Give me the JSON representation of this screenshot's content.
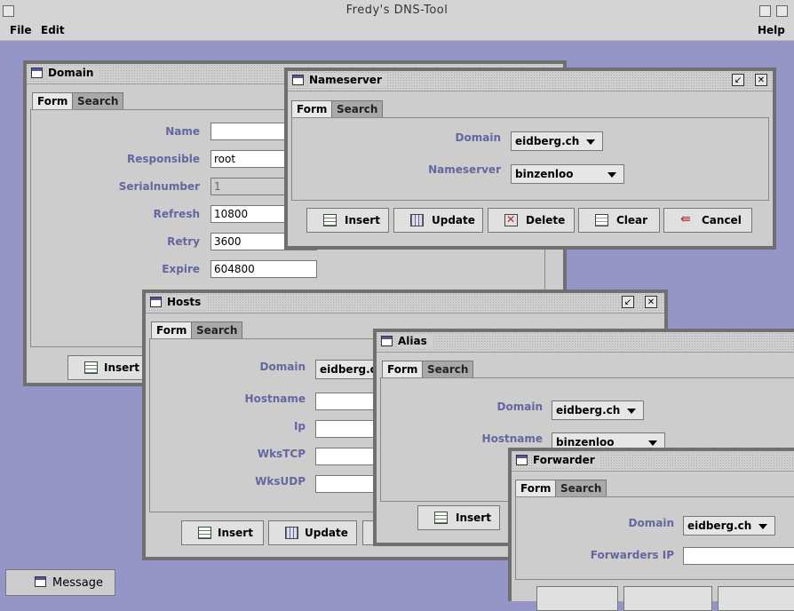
{
  "app": {
    "title": "Fredy's DNS-Tool"
  },
  "menu": {
    "file": "File",
    "edit": "Edit",
    "help": "Help"
  },
  "tabs": {
    "form": "Form",
    "search": "Search"
  },
  "buttons": {
    "insert": "Insert",
    "update": "Update",
    "delete": "Delete",
    "clear": "Clear",
    "cancel": "Cancel"
  },
  "domain_window": {
    "title": "Domain",
    "fields": [
      {
        "label": "Name",
        "value": ""
      },
      {
        "label": "Responsible",
        "value": "root"
      },
      {
        "label": "Serialnumber",
        "value": "1"
      },
      {
        "label": "Refresh",
        "value": "10800"
      },
      {
        "label": "Retry",
        "value": "3600"
      },
      {
        "label": "Expire",
        "value": "604800"
      }
    ]
  },
  "nameserver_window": {
    "title": "Nameserver",
    "domain_label": "Domain",
    "domain_value": "eidberg.ch",
    "nameserver_label": "Nameserver",
    "nameserver_value": "binzenloo"
  },
  "hosts_window": {
    "title": "Hosts",
    "domain_label": "Domain",
    "domain_value": "eidberg.ch",
    "fields": [
      {
        "label": "Hostname",
        "value": ""
      },
      {
        "label": "Ip",
        "value": ""
      },
      {
        "label": "WksTCP",
        "value": ""
      },
      {
        "label": "WksUDP",
        "value": ""
      }
    ]
  },
  "alias_window": {
    "title": "Alias",
    "domain_label": "Domain",
    "domain_value": "eidberg.ch",
    "hostname_label": "Hostname",
    "hostname_value": "binzenloo"
  },
  "forwarder_window": {
    "title": "Forwarder",
    "domain_label": "Domain",
    "domain_value": "eidberg.ch",
    "ip_label": "Forwarders IP",
    "ip_value": ""
  },
  "taskbar": {
    "message": "Message"
  },
  "colors": {
    "desktop": "#9595c8",
    "label": "#6466a0"
  }
}
